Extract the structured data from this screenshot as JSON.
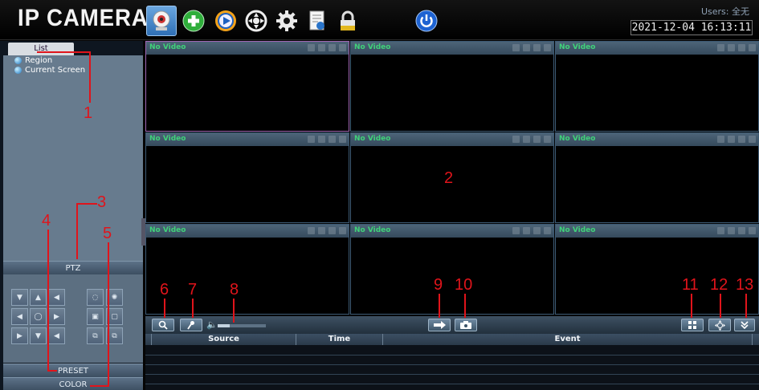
{
  "app": {
    "logo": "IP CAMERA",
    "users_label": "Users: 全无",
    "datetime": "2021-12-04 16:13:11"
  },
  "toolbar_top": [
    {
      "name": "live-view-icon",
      "active": true
    },
    {
      "name": "add-device-icon",
      "active": false
    },
    {
      "name": "playback-icon",
      "active": false
    },
    {
      "name": "ptz-wheel-icon",
      "active": false
    },
    {
      "name": "settings-gear-icon",
      "active": false
    },
    {
      "name": "log-document-icon",
      "active": false
    },
    {
      "name": "lock-icon",
      "active": false
    },
    {
      "name": "power-icon",
      "active": false
    }
  ],
  "left_panel": {
    "tab": "List",
    "tree": [
      "Region",
      "Current Screen"
    ],
    "ptz_label": "PTZ",
    "preset_label": "PRESET",
    "color_label": "COLOR"
  },
  "grid": {
    "cells": [
      "No Video",
      "No Video",
      "No Video",
      "No Video",
      "No Video",
      "No Video",
      "No Video",
      "No Video",
      "No Video"
    ],
    "selected_cell": 1
  },
  "bottom_toolbar": {
    "volume_level": 0.25
  },
  "events": {
    "columns": [
      "Source",
      "Time",
      "Event"
    ]
  },
  "annotations": [
    "1",
    "2",
    "3",
    "4",
    "5",
    "6",
    "7",
    "8",
    "9",
    "10",
    "11",
    "12",
    "13"
  ]
}
